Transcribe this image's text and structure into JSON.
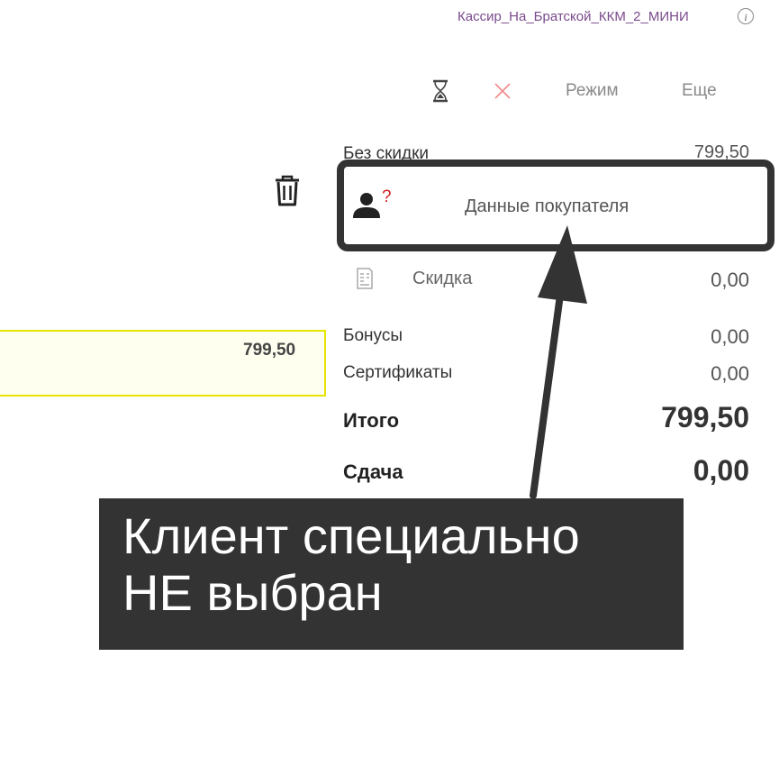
{
  "header": {
    "user_name": "Кассир_На_Братской_ККМ_2_МИНИ",
    "info_icon": "i"
  },
  "toolbar": {
    "mode_label": "Режим",
    "more_label": "Еще"
  },
  "totals": {
    "no_discount_label": "Без скидки",
    "no_discount_value": "799,50",
    "discount_label": "Скидка",
    "discount_value": "0,00",
    "bonuses_label": "Бонусы",
    "bonuses_value": "0,00",
    "certificates_label": "Сертификаты",
    "certificates_value": "0,00",
    "total_label": "Итого",
    "total_value": "799,50",
    "change_label": "Сдача",
    "change_value": "0,00"
  },
  "customer": {
    "label": "Данные покупателя",
    "question_mark": "?"
  },
  "item": {
    "price": "799,50"
  },
  "annotation": {
    "line1": "Клиент специально",
    "line2": "НЕ выбран"
  },
  "colors": {
    "annotation_bg": "#333333",
    "highlight_border": "#333333",
    "item_border": "#e6e400",
    "user_name": "#7a4a8c",
    "question_mark": "#d02020"
  }
}
